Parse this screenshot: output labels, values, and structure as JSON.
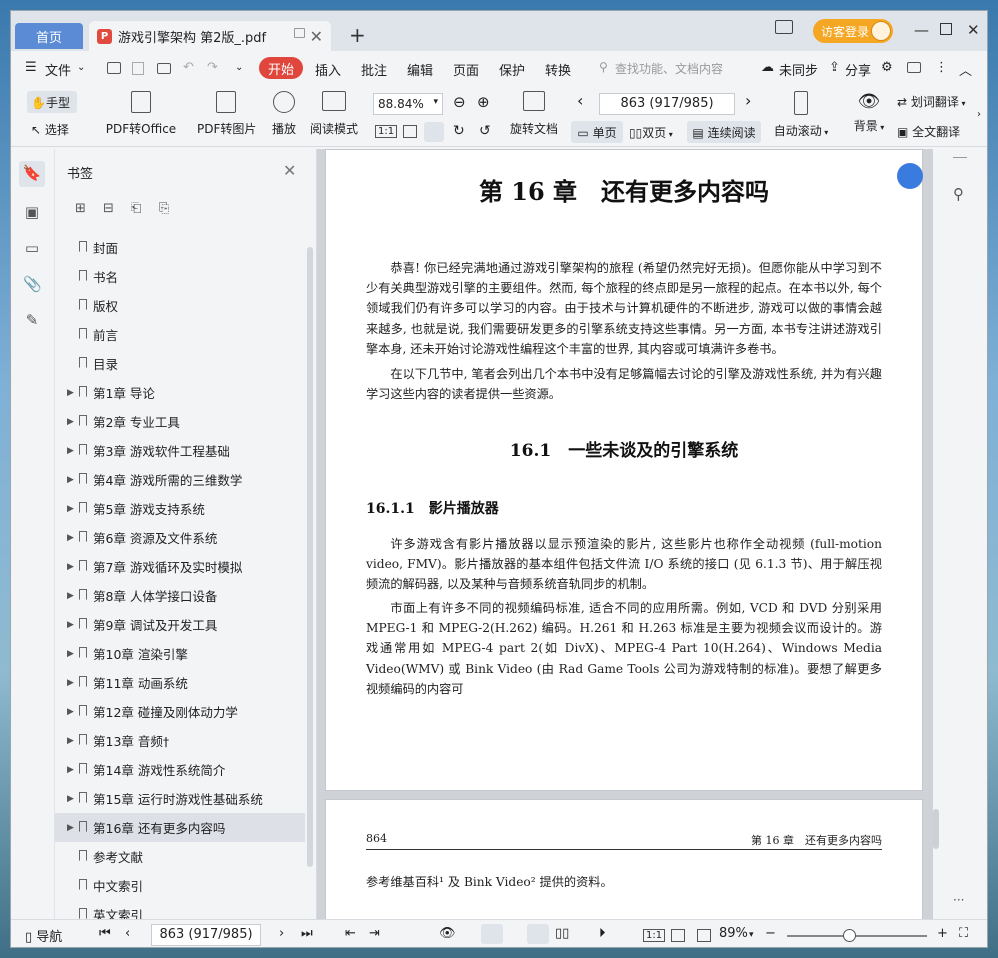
{
  "titlebar": {
    "home_tab": "首页",
    "doc_tab": "游戏引擎架构 第2版_.pdf",
    "new_tab": "+",
    "login": "访客登录",
    "pdf_badge": "P"
  },
  "menu": {
    "file": "文件",
    "start": "开始",
    "insert": "插入",
    "annotate": "批注",
    "edit": "编辑",
    "page": "页面",
    "protect": "保护",
    "convert": "转换",
    "search_placeholder": "查找功能、文档内容",
    "sync": "未同步",
    "share": "分享"
  },
  "toolbar": {
    "hand": "手型",
    "select": "选择",
    "to_office": "PDF转Office",
    "to_image": "PDF转图片",
    "play": "播放",
    "read_mode": "阅读模式",
    "zoom": "88.84%",
    "rotate": "旋转文档",
    "page_input": "863 (917/985)",
    "single": "单页",
    "double": "双页",
    "continuous": "连续阅读",
    "autoscroll": "自动滚动",
    "background": "背景",
    "word_translate": "划词翻译",
    "full_translate": "全文翻译"
  },
  "panel": {
    "title": "书签",
    "bookmarks": [
      {
        "label": "封面",
        "expandable": false
      },
      {
        "label": "书名",
        "expandable": false
      },
      {
        "label": "版权",
        "expandable": false
      },
      {
        "label": "前言",
        "expandable": false
      },
      {
        "label": "目录",
        "expandable": false
      },
      {
        "label": "第1章 导论",
        "expandable": true
      },
      {
        "label": "第2章 专业工具",
        "expandable": true
      },
      {
        "label": "第3章 游戏软件工程基础",
        "expandable": true
      },
      {
        "label": "第4章 游戏所需的三维数学",
        "expandable": true
      },
      {
        "label": "第5章 游戏支持系统",
        "expandable": true
      },
      {
        "label": "第6章 资源及文件系统",
        "expandable": true
      },
      {
        "label": "第7章 游戏循环及实时模拟",
        "expandable": true
      },
      {
        "label": "第8章 人体学接口设备",
        "expandable": true
      },
      {
        "label": "第9章 调试及开发工具",
        "expandable": true
      },
      {
        "label": "第10章 渲染引擎",
        "expandable": true
      },
      {
        "label": "第11章 动画系统",
        "expandable": true
      },
      {
        "label": "第12章 碰撞及刚体动力学",
        "expandable": true
      },
      {
        "label": "第13章 音频†",
        "expandable": true
      },
      {
        "label": "第14章 游戏性系统简介",
        "expandable": true
      },
      {
        "label": "第15章 运行时游戏性基础系统",
        "expandable": true
      },
      {
        "label": "第16章 还有更多内容吗",
        "expandable": true,
        "active": true
      },
      {
        "label": "参考文献",
        "expandable": false
      },
      {
        "label": "中文索引",
        "expandable": false
      },
      {
        "label": "英文索引",
        "expandable": false
      }
    ]
  },
  "page1": {
    "chapter_title": "第 16 章　还有更多内容吗",
    "p1": "恭喜! 你已经完满地通过游戏引擎架构的旅程 (希望仍然完好无损)。但愿你能从中学习到不少有关典型游戏引擎的主要组件。然而, 每个旅程的终点即是另一旅程的起点。在本书以外, 每个领域我们仍有许多可以学习的内容。由于技术与计算机硬件的不断进步, 游戏可以做的事情会越来越多, 也就是说, 我们需要研发更多的引擎系统支持这些事情。另一方面, 本书专注讲述游戏引擎本身, 还未开始讨论游戏性编程这个丰富的世界, 其内容或可填满许多卷书。",
    "p2": "在以下几节中, 笔者会列出几个本书中没有足够篇幅去讨论的引擎及游戏性系统, 并为有兴趣学习这些内容的读者提供一些资源。",
    "section": "16.1　一些未谈及的引擎系统",
    "subsection": "16.1.1　影片播放器",
    "p3": "许多游戏含有影片播放器以显示预渲染的影片, 这些影片也称作全动视频 (full-motion video, FMV)。影片播放器的基本组件包括文件流 I/O 系统的接口 (见 6.1.3 节)、用于解压视频流的解码器, 以及某种与音频系统音轨同步的机制。",
    "p4": "市面上有许多不同的视频编码标准, 适合不同的应用所需。例如, VCD 和 DVD 分别采用 MPEG-1 和 MPEG-2(H.262) 编码。H.261 和 H.263 标准是主要为视频会议而设计的。游戏通常用如 MPEG-4 part 2(如 DivX)、MPEG-4 Part 10(H.264)、Windows Media Video(WMV) 或 Bink Video (由 Rad Game Tools 公司为游戏特制的标准)。要想了解更多视频编码的内容可"
  },
  "page2": {
    "page_num": "864",
    "running_head": "第 16 章　还有更多内容吗",
    "line": "参考维基百科¹ 及 Bink Video² 提供的资料。"
  },
  "status": {
    "nav": "导航",
    "page_input": "863 (917/985)",
    "zoom": "89%"
  }
}
